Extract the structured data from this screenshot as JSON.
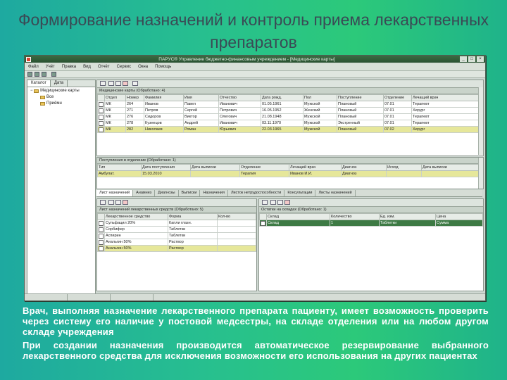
{
  "slide": {
    "title": "Формирование назначений и контроль приема лекарственных препаратов",
    "paragraphs": [
      "Врач, выполняя назначение лекарственного препарата пациенту, имеет возможность проверить через систему его наличие у постовой медсестры, на складе отделения или на любом другом складе учреждения",
      "При создании назначения производится автоматическое резервирование выбранного лекарственного средства для исключения возможности его использования на других пациентах"
    ]
  },
  "app": {
    "window_title": "ПАРУС® Управление бюджетно-финансовым учреждением - [Медицинские карты]",
    "menu": [
      "Файл",
      "Учёт",
      "Правка",
      "Вид",
      "Отчёт",
      "Сервис",
      "Окна",
      "Помощь"
    ],
    "left_tabs": [
      "Каталог",
      "Дата"
    ],
    "tree_root": "Медицинские карты",
    "tree_items": [
      "Все",
      "Приёмн"
    ],
    "top_caption": "Медицинские карты (Обработано: 4)",
    "top_columns": [
      "",
      "Отдел",
      "Номер",
      "Фамилия",
      "Имя",
      "Отчество",
      "Дата рожд.",
      "Пол",
      "Поступление",
      "Отделение",
      "Лечащий врач"
    ],
    "top_rows": [
      [
        "",
        "МК",
        "264",
        "Иванов",
        "Павел",
        "Иванович",
        "01.05.1961",
        "Мужской",
        "Плановый",
        "07.01",
        "Терапевт"
      ],
      [
        "",
        "МК",
        "271",
        "Петров",
        "Сергей",
        "Петрович",
        "16.05.1952",
        "Женский",
        "Плановый",
        "07.01",
        "Хирург"
      ],
      [
        "",
        "МК",
        "276",
        "Сидоров",
        "Виктор",
        "Олегович",
        "21.08.1948",
        "Мужской",
        "Плановый",
        "07.01",
        "Терапевт"
      ],
      [
        "",
        "МК",
        "278",
        "Кузнецов",
        "Андрей",
        "Иванович",
        "03.11.1970",
        "Мужской",
        "Экстренный",
        "07.01",
        "Терапевт"
      ],
      [
        "",
        "МК",
        "282",
        "Николаев",
        "Роман",
        "Юрьевич",
        "22.03.1965",
        "Мужской",
        "Плановый",
        "07.02",
        "Хирург"
      ]
    ],
    "mid_caption": "Поступления в отделение (Обработано: 1)",
    "mid_columns": [
      "Тип",
      "Дата поступления",
      "Дата выписки",
      "Отделение",
      "Лечащий врач",
      "Диагноз",
      "Исход",
      "Дата выписки"
    ],
    "mid_rows": [
      [
        "Амбулат.",
        "15.03.2010",
        "",
        "Терапия",
        "Иванов И.И.",
        "Диагноз",
        "",
        ""
      ]
    ],
    "tabs": [
      "Лист назначений",
      "Анамнез",
      "Диагнозы",
      "Выписки",
      "Назначения",
      "Листок нетрудоспособности",
      "Консультации",
      "Листы назначений"
    ],
    "left_grid_caption": "Лист назначений лекарственных средств (Обработано: 5)",
    "left_grid_columns": [
      "",
      "Лекарственное средство",
      "Форма",
      "Кол-во"
    ],
    "left_grid_rows": [
      [
        "",
        "Сульфацил 20%",
        "Капли глазн.",
        ""
      ],
      [
        "",
        "Сорбифер",
        "Таблетки",
        ""
      ],
      [
        "",
        "Аспирин",
        "Таблетки",
        ""
      ],
      [
        "",
        "Анальгин 50%",
        "Раствор",
        ""
      ],
      [
        "",
        "Анальгин 50%",
        "Раствор",
        ""
      ]
    ],
    "right_grid_caption": "Остатки на складах (Обработано: 1)",
    "right_grid_columns": [
      "",
      "Склад",
      "Количество",
      "Ед. изм.",
      "Цена"
    ],
    "right_grid_rows": [
      [
        "",
        "Склад",
        "1",
        "Таблетки",
        "Сумма"
      ]
    ]
  }
}
